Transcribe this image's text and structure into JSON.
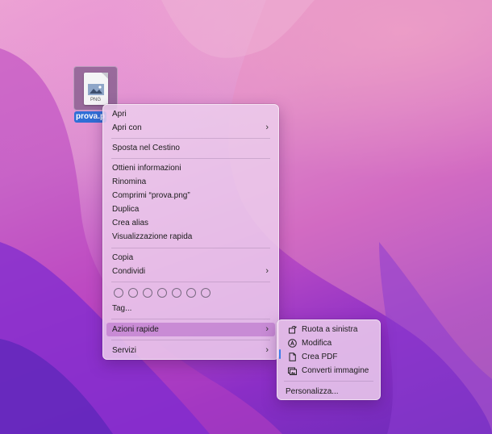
{
  "desktop": {
    "file_icon": {
      "name": "prova.p",
      "type_label": "PNG",
      "icon": "png-file-icon"
    }
  },
  "context_menu": {
    "items": [
      {
        "label": "Apri"
      },
      {
        "label": "Apri con",
        "submenu": true
      },
      {
        "label": "Sposta nel Cestino"
      },
      {
        "label": "Ottieni informazioni"
      },
      {
        "label": "Rinomina"
      },
      {
        "label": "Comprimi “prova.png”"
      },
      {
        "label": "Duplica"
      },
      {
        "label": "Crea alias"
      },
      {
        "label": "Visualizzazione rapida"
      },
      {
        "label": "Copia"
      },
      {
        "label": "Condividi",
        "submenu": true
      },
      {
        "label": "Tag..."
      },
      {
        "label": "Azioni rapide",
        "submenu": true,
        "highlighted": true
      },
      {
        "label": "Servizi",
        "submenu": true
      }
    ],
    "tag_colors_count": 7,
    "chevron": "›"
  },
  "quick_actions_submenu": {
    "items": [
      {
        "label": "Ruota a sinistra",
        "icon": "rotate-left-icon"
      },
      {
        "label": "Modifica",
        "icon": "markup-icon"
      },
      {
        "label": "Crea PDF",
        "icon": "pdf-document-icon"
      },
      {
        "label": "Converti immagine",
        "icon": "convert-image-icon"
      }
    ],
    "customize_label": "Personalizza..."
  },
  "colors": {
    "selection": "#2f6fd6",
    "highlight": "#be78cd"
  }
}
